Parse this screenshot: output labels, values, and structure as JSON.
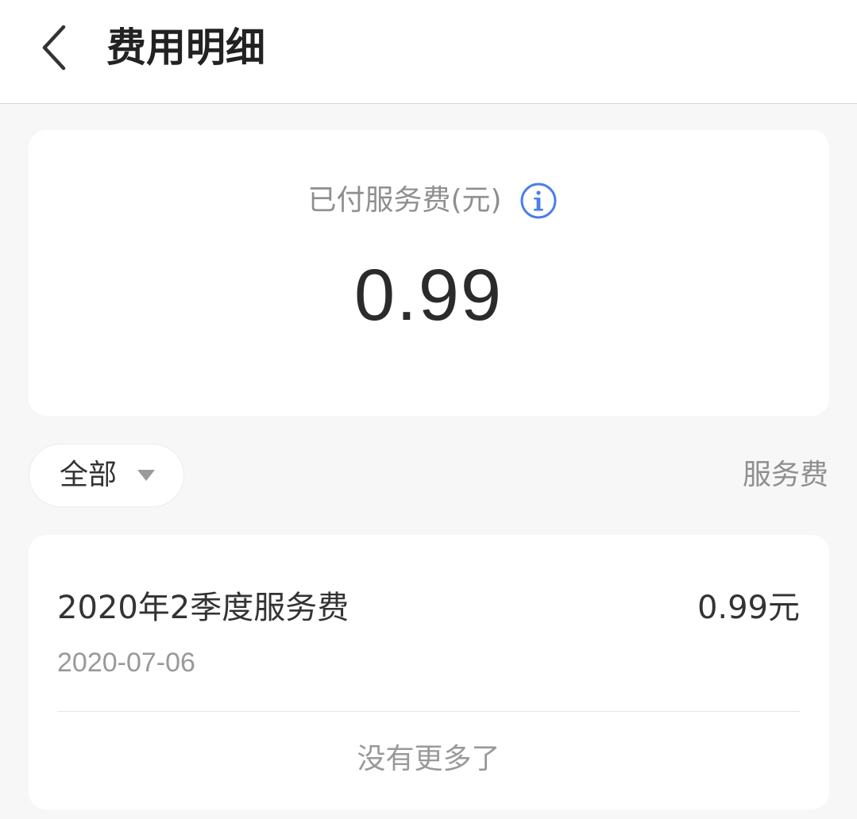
{
  "header": {
    "title": "费用明细",
    "back_icon": "back-arrow-icon"
  },
  "summary": {
    "label": "已付服务费(元)",
    "info_icon": "info-icon",
    "amount": "0.99"
  },
  "filter": {
    "selected": "全部",
    "dropdown_icon": "caret-down-icon",
    "type_label": "服务费"
  },
  "list": {
    "items": [
      {
        "title": "2020年2季度服务费",
        "amount": "0.99元",
        "date": "2020-07-06"
      }
    ],
    "end_text": "没有更多了"
  },
  "colors": {
    "background": "#f7f7f7",
    "card": "#ffffff",
    "accent_blue": "#4a7fe8",
    "primary_text": "#333333",
    "secondary_text": "#999999"
  }
}
